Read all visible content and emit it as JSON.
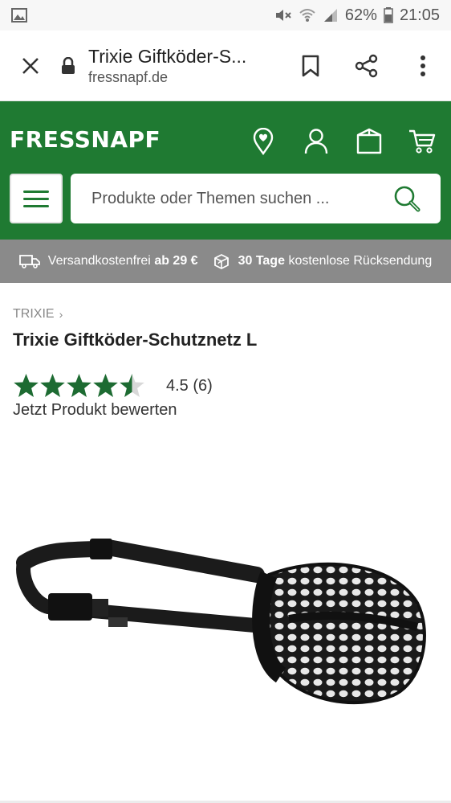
{
  "status_bar": {
    "battery": "62%",
    "time": "21:05"
  },
  "tab": {
    "title": "Trixie Giftköder-S...",
    "url": "fressnapf.de"
  },
  "header": {
    "logo": "FRESSNAPF",
    "search_placeholder": "Produkte oder Themen suchen ..."
  },
  "shipping": {
    "free_shipping_text": "Versandkostenfrei",
    "free_shipping_threshold": "ab 29 €",
    "return_days": "30 Tage",
    "return_text": "kostenlose Rücksendung"
  },
  "product": {
    "breadcrumb": "TRIXIE",
    "breadcrumb_chevron": "›",
    "title": "Trixie Giftköder-Schutznetz L",
    "rating_value": 4.5,
    "rating_text": "4.5 (6)",
    "rate_link": "Jetzt Produkt bewerten"
  },
  "colors": {
    "brand_green": "#1f7a32",
    "banner_grey": "#8a8a8a",
    "star_green": "#1d6b32"
  }
}
